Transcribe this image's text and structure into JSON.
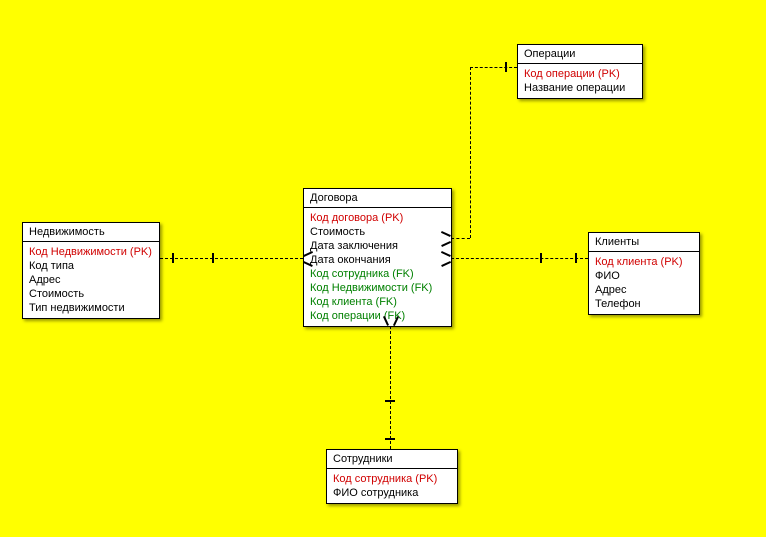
{
  "entities": {
    "nedvizhimost": {
      "title": "Недвижимость",
      "attrs": [
        {
          "text": "Код Недвижимости (PK)",
          "kind": "pk"
        },
        {
          "text": "Код типа",
          "kind": "norm"
        },
        {
          "text": "Адрес",
          "kind": "norm"
        },
        {
          "text": "Стоимость",
          "kind": "norm"
        },
        {
          "text": "Тип недвижимости",
          "kind": "norm"
        }
      ]
    },
    "dogovora": {
      "title": "Договора",
      "attrs": [
        {
          "text": "Код договора (PK)",
          "kind": "pk"
        },
        {
          "text": "Стоимость",
          "kind": "norm"
        },
        {
          "text": "Дата заключения",
          "kind": "norm"
        },
        {
          "text": "Дата окончания",
          "kind": "norm"
        },
        {
          "text": "Код сотрудника (FK)",
          "kind": "fk"
        },
        {
          "text": "Код Недвижимости (FK)",
          "kind": "fk"
        },
        {
          "text": "Код клиента (FK)",
          "kind": "fk"
        },
        {
          "text": "Код операции (FK)",
          "kind": "fk"
        }
      ]
    },
    "operatsii": {
      "title": "Операции",
      "attrs": [
        {
          "text": "Код операции (PK)",
          "kind": "pk"
        },
        {
          "text": "Название операции",
          "kind": "norm"
        }
      ]
    },
    "klienty": {
      "title": "Клиенты",
      "attrs": [
        {
          "text": "Код клиента (PK)",
          "kind": "pk"
        },
        {
          "text": "ФИО",
          "kind": "norm"
        },
        {
          "text": "Адрес",
          "kind": "norm"
        },
        {
          "text": "Телефон",
          "kind": "norm"
        }
      ]
    },
    "sotrudniki": {
      "title": "Сотрудники",
      "attrs": [
        {
          "text": "Код сотрудника (PK)",
          "kind": "pk"
        },
        {
          "text": "ФИО сотрудника",
          "kind": "norm"
        }
      ]
    }
  }
}
